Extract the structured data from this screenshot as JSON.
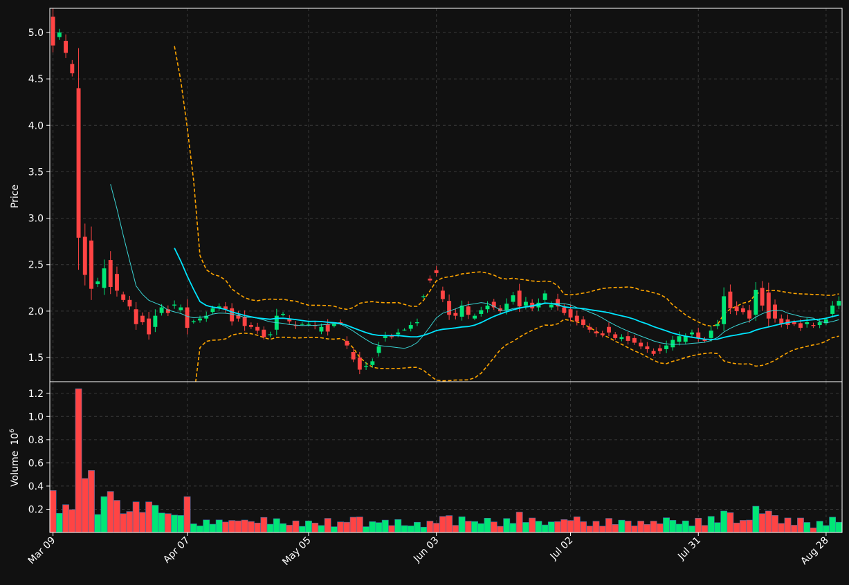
{
  "chart_data": {
    "type": "candlestick",
    "dates": [
      "Mar 09",
      "Mar 10",
      "Mar 11",
      "Mar 12",
      "Mar 13",
      "Mar 16",
      "Mar 17",
      "Mar 18",
      "Mar 19",
      "Mar 20",
      "Mar 23",
      "Mar 24",
      "Mar 25",
      "Mar 26",
      "Mar 27",
      "Mar 30",
      "Mar 31",
      "Apr 01",
      "Apr 02",
      "Apr 03",
      "Apr 06",
      "Apr 07",
      "Apr 08",
      "Apr 09",
      "Apr 13",
      "Apr 14",
      "Apr 15",
      "Apr 16",
      "Apr 17",
      "Apr 20",
      "Apr 21",
      "Apr 22",
      "Apr 23",
      "Apr 24",
      "Apr 27",
      "Apr 28",
      "Apr 29",
      "Apr 30",
      "May 01",
      "May 04",
      "May 05",
      "May 06",
      "May 07",
      "May 08",
      "May 11",
      "May 12",
      "May 13",
      "May 14",
      "May 15",
      "May 18",
      "May 19",
      "May 20",
      "May 21",
      "May 22",
      "May 26",
      "May 27",
      "May 28",
      "May 29",
      "Jun 01",
      "Jun 02",
      "Jun 03",
      "Jun 04",
      "Jun 05",
      "Jun 08",
      "Jun 09",
      "Jun 10",
      "Jun 11",
      "Jun 12",
      "Jun 15",
      "Jun 16",
      "Jun 17",
      "Jun 18",
      "Jun 19",
      "Jun 22",
      "Jun 23",
      "Jun 24",
      "Jun 25",
      "Jun 26",
      "Jun 29",
      "Jun 30",
      "Jul 01",
      "Jul 02",
      "Jul 06",
      "Jul 07",
      "Jul 08",
      "Jul 09",
      "Jul 10",
      "Jul 13",
      "Jul 14",
      "Jul 15",
      "Jul 16",
      "Jul 17",
      "Jul 20",
      "Jul 21",
      "Jul 22",
      "Jul 23",
      "Jul 24",
      "Jul 27",
      "Jul 28",
      "Jul 29",
      "Jul 30",
      "Jul 31",
      "Aug 03",
      "Aug 04",
      "Aug 05",
      "Aug 06",
      "Aug 07",
      "Aug 10",
      "Aug 11",
      "Aug 12",
      "Aug 13",
      "Aug 14",
      "Aug 17",
      "Aug 18",
      "Aug 19",
      "Aug 20",
      "Aug 21",
      "Aug 24",
      "Aug 25",
      "Aug 26",
      "Aug 27",
      "Aug 28",
      "Aug 31",
      "Sep 01",
      "Sep 02",
      "Sep 03",
      "Sep 04",
      "Sep 08"
    ],
    "open": [
      5.17,
      4.95,
      4.91,
      4.66,
      4.4,
      2.8,
      2.76,
      2.29,
      2.25,
      2.55,
      2.4,
      2.18,
      2.12,
      2.02,
      1.95,
      1.92,
      1.83,
      1.98,
      2.02,
      2.06,
      2.01,
      2.04,
      1.88,
      1.9,
      1.92,
      1.99,
      2.03,
      2.05,
      2.03,
      1.96,
      1.94,
      1.85,
      1.83,
      1.8,
      1.74,
      1.8,
      1.96,
      1.92,
      1.85,
      1.86,
      1.86,
      1.85,
      1.78,
      1.86,
      1.84,
      1.88,
      1.68,
      1.56,
      1.5,
      1.4,
      1.42,
      1.55,
      1.71,
      1.73,
      1.75,
      1.8,
      1.81,
      1.87,
      2.15,
      2.35,
      2.44,
      2.22,
      2.11,
      1.98,
      1.94,
      2.05,
      1.92,
      1.97,
      2.02,
      2.1,
      2.03,
      2.01,
      2.1,
      2.22,
      2.06,
      2.09,
      2.04,
      2.12,
      2.04,
      2.13,
      2.04,
      2.02,
      1.95,
      1.91,
      1.83,
      1.78,
      1.76,
      1.83,
      1.75,
      1.7,
      1.73,
      1.71,
      1.66,
      1.62,
      1.57,
      1.6,
      1.59,
      1.61,
      1.67,
      1.67,
      1.75,
      1.77,
      1.7,
      1.71,
      1.84,
      1.86,
      2.21,
      2.05,
      2.03,
      2.01,
      1.96,
      2.25,
      2.2,
      2.07,
      1.92,
      1.91,
      1.88,
      1.87,
      1.86,
      1.85,
      1.85,
      1.87,
      1.97,
      2.06,
      2.01
    ],
    "close": [
      4.86,
      5.0,
      4.78,
      4.56,
      2.79,
      2.39,
      2.24,
      2.32,
      2.46,
      2.26,
      2.22,
      2.12,
      2.05,
      1.86,
      1.88,
      1.75,
      1.95,
      2.04,
      1.98,
      2.07,
      2.04,
      1.82,
      1.89,
      1.92,
      1.95,
      2.03,
      2.05,
      2.02,
      1.89,
      1.92,
      1.84,
      1.83,
      1.79,
      1.72,
      1.75,
      1.95,
      1.97,
      1.89,
      1.84,
      1.86,
      1.86,
      1.84,
      1.83,
      1.78,
      1.86,
      1.87,
      1.63,
      1.48,
      1.37,
      1.41,
      1.46,
      1.62,
      1.73,
      1.72,
      1.77,
      1.8,
      1.85,
      1.88,
      2.16,
      2.33,
      2.41,
      2.13,
      1.96,
      1.95,
      2.06,
      1.96,
      1.95,
      2.01,
      2.06,
      2.04,
      2.0,
      2.08,
      2.17,
      2.05,
      2.1,
      2.03,
      2.09,
      2.19,
      2.07,
      2.05,
      1.98,
      1.93,
      1.89,
      1.85,
      1.8,
      1.76,
      1.74,
      1.77,
      1.71,
      1.72,
      1.68,
      1.66,
      1.62,
      1.59,
      1.54,
      1.57,
      1.63,
      1.69,
      1.73,
      1.73,
      1.77,
      1.71,
      1.68,
      1.79,
      1.86,
      2.16,
      2.03,
      2.0,
      1.99,
      1.92,
      2.23,
      2.06,
      1.92,
      1.92,
      1.86,
      1.85,
      1.86,
      1.82,
      1.88,
      1.84,
      1.88,
      1.91,
      2.06,
      2.11
    ]
  },
  "axes": {
    "price_label": "Price",
    "volume_label": "Volume",
    "volume_exponent": "10",
    "volume_exponent_power": "6",
    "price_ticks": [
      "1.5",
      "2.0",
      "2.5",
      "3.0",
      "3.5",
      "4.0",
      "4.5",
      "5.0"
    ],
    "volume_ticks": [
      "0.2",
      "0.4",
      "0.6",
      "0.8",
      "1.0",
      "1.2"
    ],
    "date_ticks": [
      "Mar 09",
      "Apr 07",
      "May 05",
      "Jun 03",
      "Jul 02",
      "Jul 31",
      "Aug 28"
    ]
  },
  "colors": {
    "background": "#111111",
    "up": "#00e676",
    "down": "#ff4444",
    "ma_short": "#3ad4d4",
    "ma_long": "#00e5ff",
    "bollinger": "#ffa500",
    "grid": "#3a3a3a",
    "text": "#ffffff"
  }
}
